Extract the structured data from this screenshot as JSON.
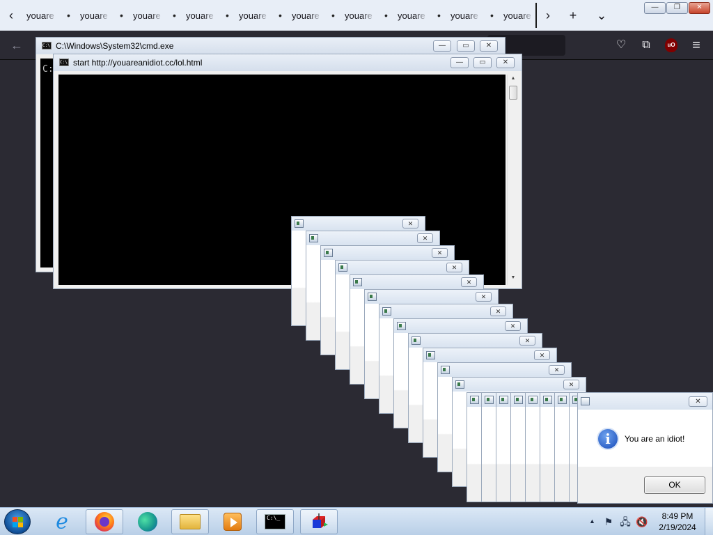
{
  "browser": {
    "tabs": [
      {
        "label": "youareanidiot"
      },
      {
        "label": "youareanidiot"
      },
      {
        "label": "youareanidiot"
      },
      {
        "label": "youareanidiot"
      },
      {
        "label": "youareanidiot"
      },
      {
        "label": "youareanidiot"
      },
      {
        "label": "youareanidiot"
      },
      {
        "label": "youareanidiot"
      },
      {
        "label": "youareanidiot"
      },
      {
        "label": "youareanidiot"
      }
    ],
    "scroll_left_icon": "‹",
    "scroll_right_icon": "›",
    "new_tab_icon": "+",
    "list_tabs_icon": "⌄",
    "back_icon": "←",
    "window_controls": {
      "minimize": "—",
      "restore": "❐",
      "close": "✕"
    },
    "toolbar_icons": {
      "pocket": "♡",
      "extensions": "⧉",
      "ublock_label": "uO",
      "menu": "≡"
    }
  },
  "cmd_back": {
    "title": "C:\\Windows\\System32\\cmd.exe",
    "prompt": "C:"
  },
  "cmd_front": {
    "title": "start  http://youareanidiot.cc/lol.html",
    "scroll_up": "▲",
    "scroll_down": "▼"
  },
  "window_buttons": {
    "minimize": "—",
    "maximize": "▭",
    "close": "✕"
  },
  "message_box": {
    "text": "You are an idiot!",
    "ok_label": "OK",
    "info_glyph": "i",
    "close_glyph": "✕"
  },
  "taskbar": {
    "clock_time": "8:49 PM",
    "clock_date": "2/19/2024",
    "tray_arrow": "▲",
    "tray_icons": {
      "flag": "⚑",
      "network": "🖧",
      "volume": "🔇"
    },
    "pinned": [
      "internet-explorer",
      "firefox",
      "edge",
      "file-explorer",
      "media-player",
      "command-prompt",
      "app"
    ]
  },
  "colors": {
    "firefox_toolbar": "#2b2a33",
    "tab_strip": "#e8eef7",
    "console_background": "#000000",
    "taskbar": "#c9dbef",
    "info_icon": "#1549b9"
  }
}
